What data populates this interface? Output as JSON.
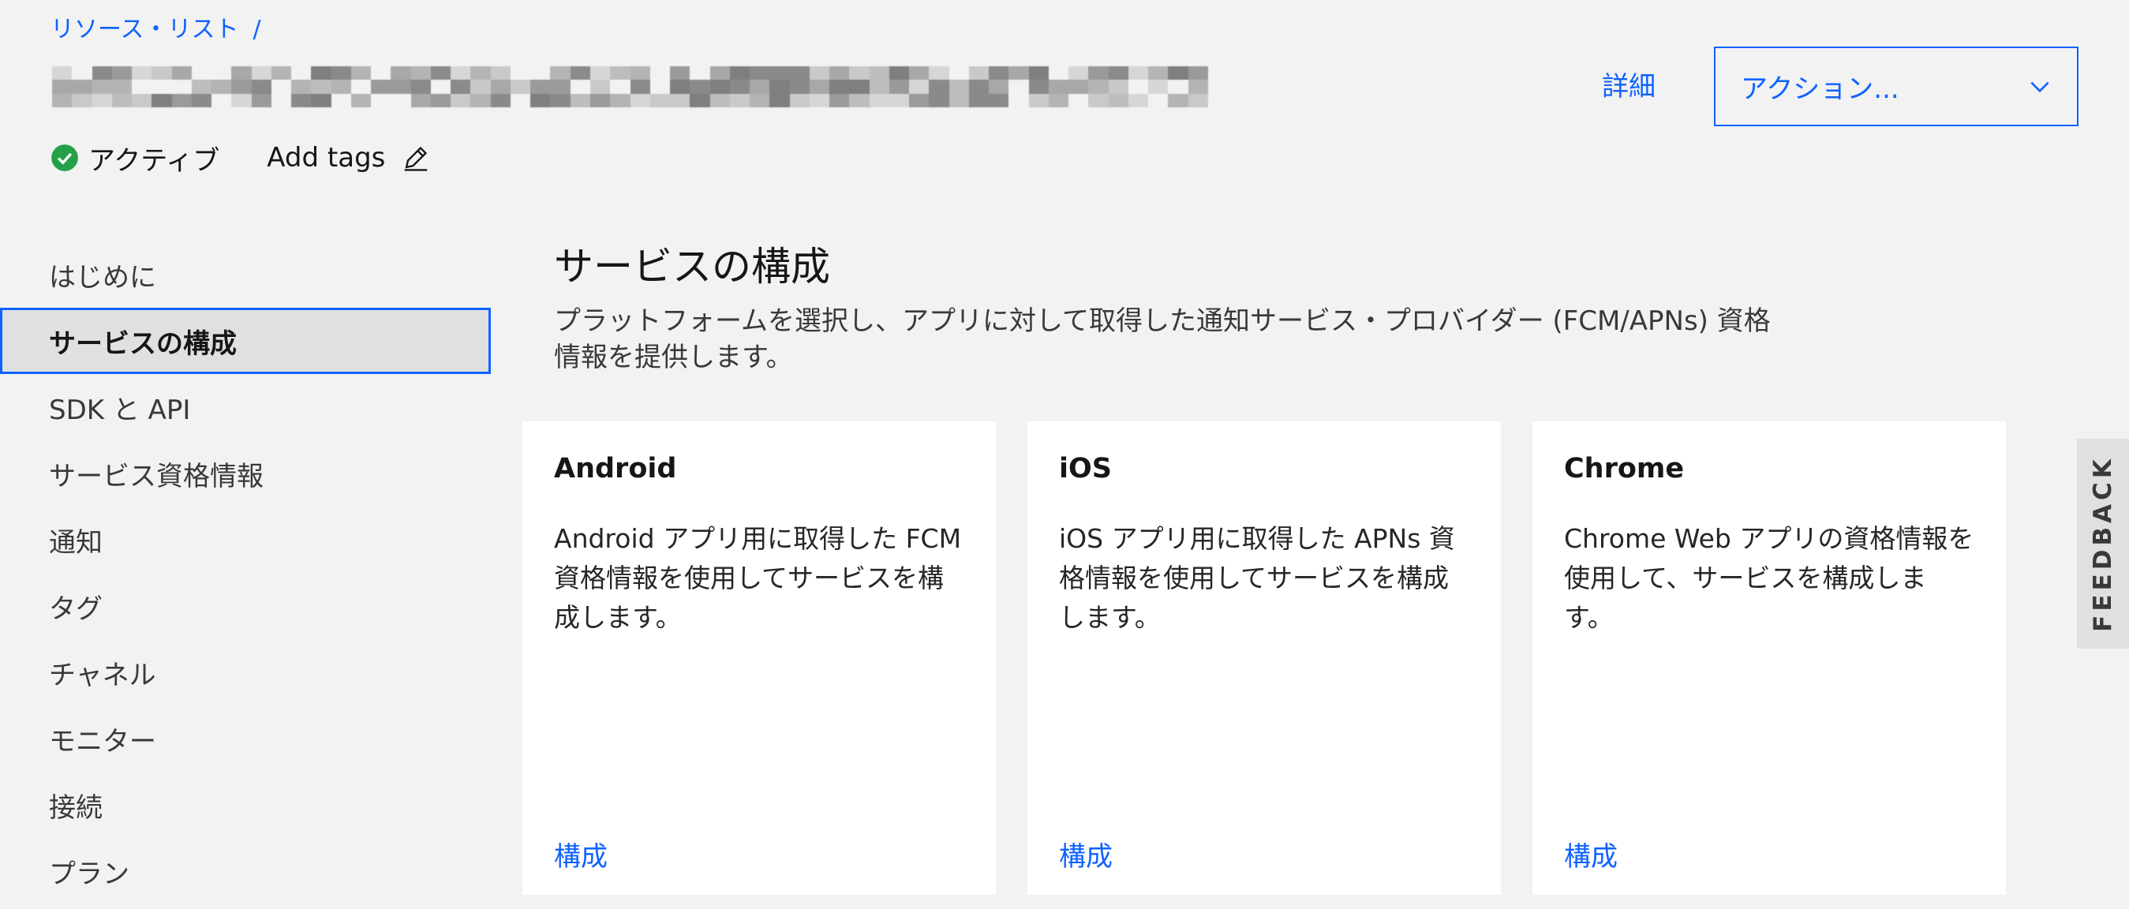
{
  "breadcrumb": {
    "items": [
      "リソース・リスト"
    ],
    "separator": "/"
  },
  "header": {
    "details_link": "詳細",
    "actions_dropdown": {
      "label": "アクション...",
      "icon": "chevron-down-icon"
    }
  },
  "status": {
    "label": "アクティブ",
    "icon": "checkmark-filled-icon",
    "color": "#24a148"
  },
  "tags": {
    "add_label": "Add tags",
    "icon": "edit-pencil-icon"
  },
  "sidebar": {
    "items": [
      {
        "label": "はじめに",
        "active": false
      },
      {
        "label": "サービスの構成",
        "active": true
      },
      {
        "label": "SDK と API",
        "active": false
      },
      {
        "label": "サービス資格情報",
        "active": false
      },
      {
        "label": "通知",
        "active": false
      },
      {
        "label": "タグ",
        "active": false
      },
      {
        "label": "チャネル",
        "active": false
      },
      {
        "label": "モニター",
        "active": false
      },
      {
        "label": "接続",
        "active": false
      },
      {
        "label": "プラン",
        "active": false
      }
    ]
  },
  "main": {
    "title": "サービスの構成",
    "description": "プラットフォームを選択し、アプリに対して取得した通知サービス・プロバイダー (FCM/APNs) 資格情報を提供します。",
    "cards": [
      {
        "title": "Android",
        "body": "Android アプリ用に取得した FCM 資格情報を使用してサービスを構成します。",
        "link": "構成"
      },
      {
        "title": "iOS",
        "body": "iOS アプリ用に取得した APNs 資格情報を使用してサービスを構成します。",
        "link": "構成"
      },
      {
        "title": "Chrome",
        "body": "Chrome Web アプリの資格情報を使用して、サービスを構成します。",
        "link": "構成"
      }
    ]
  },
  "feedback": {
    "label": "FEEDBACK"
  },
  "colors": {
    "accent": "#0f62fe",
    "background": "#f2f2f2",
    "card_background": "#ffffff",
    "active_item_background": "#e0e0e0"
  }
}
